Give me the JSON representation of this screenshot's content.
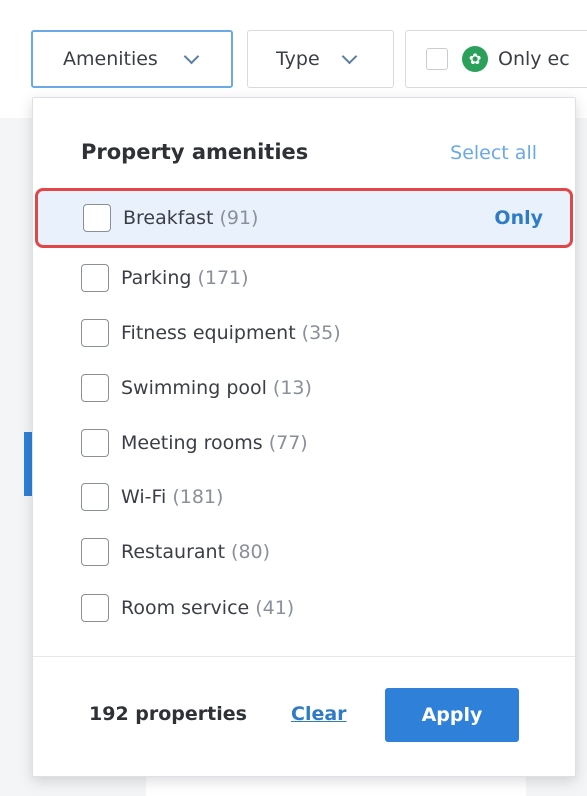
{
  "filterbar": {
    "amenities_label": "Amenities",
    "type_label": "Type",
    "eco_label": "Only ec"
  },
  "dropdown": {
    "title": "Property amenities",
    "select_all": "Select all",
    "only_label": "Only",
    "options": [
      {
        "label": "Breakfast",
        "count": "(91)"
      },
      {
        "label": "Parking",
        "count": "(171)"
      },
      {
        "label": "Fitness equipment",
        "count": "(35)"
      },
      {
        "label": "Swimming pool",
        "count": "(13)"
      },
      {
        "label": "Meeting rooms",
        "count": "(77)"
      },
      {
        "label": "Wi-Fi",
        "count": "(181)"
      },
      {
        "label": "Restaurant",
        "count": "(80)"
      },
      {
        "label": "Room service",
        "count": "(41)"
      }
    ],
    "footer": {
      "properties": "192 properties",
      "clear": "Clear",
      "apply": "Apply"
    }
  },
  "colors": {
    "accent": "#2f80d8",
    "highlight_outline": "#e24646",
    "eco_green": "#2aa05a"
  }
}
